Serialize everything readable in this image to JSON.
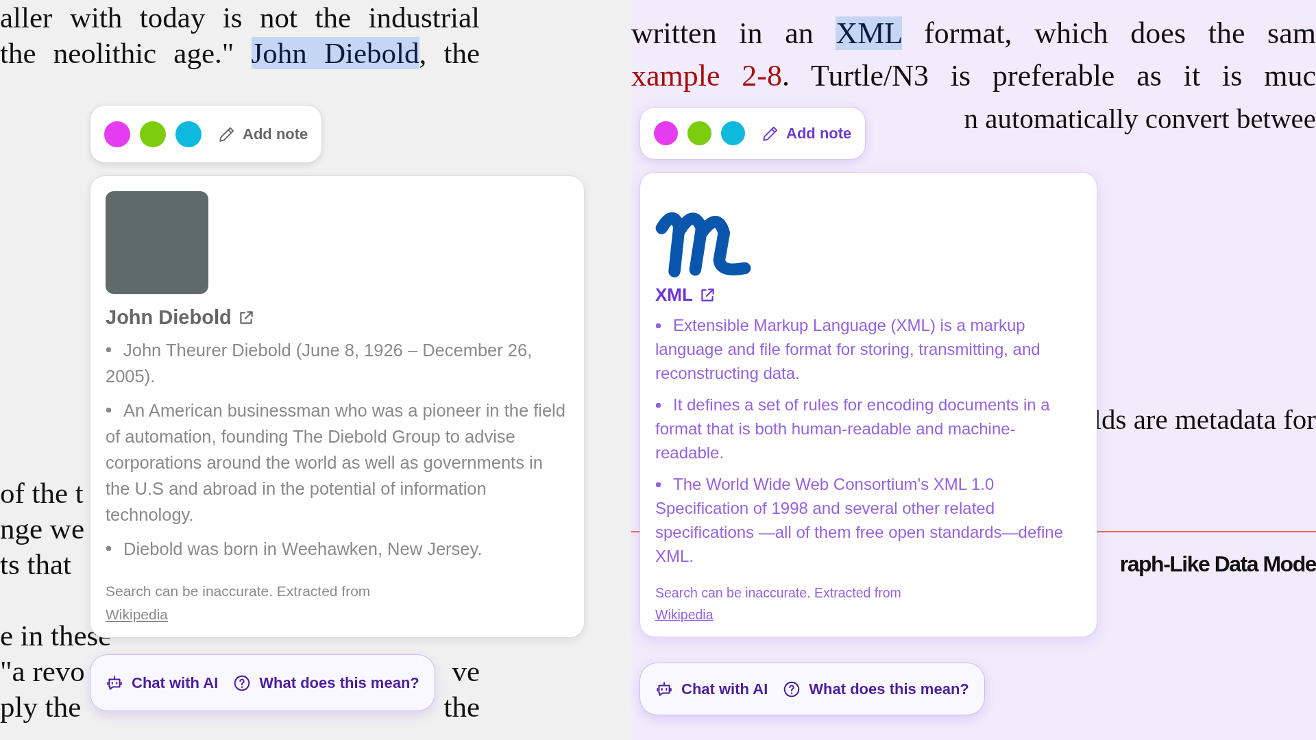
{
  "panes": [
    {
      "kind": "gray",
      "blocks": [
        {
          "lines": [
            {
              "kind": "full",
              "left": [
                {
                  "kind": "plain",
                  "text": "aller with today is not the industrial"
                }
              ]
            },
            {
              "kind": "full",
              "left": [
                {
                  "kind": "plain",
                  "text": "the neolithic age.\" "
                },
                {
                  "kind": "highlight",
                  "text": "John Diebold"
                },
                {
                  "kind": "plain",
                  "text": ", the"
                }
              ]
            }
          ]
        },
        {
          "lines": [
            {
              "kind": "split",
              "left": [
                {
                  "kind": "plain",
                  "text": "of the t"
                }
              ]
            },
            {
              "kind": "split",
              "left": [
                {
                  "kind": "plain",
                  "text": "nge we"
                }
              ]
            },
            {
              "kind": "split",
              "left": [
                {
                  "kind": "plain",
                  "text": "ts that"
                }
              ]
            }
          ]
        },
        {
          "lines": [
            {
              "kind": "split",
              "left": [
                {
                  "kind": "plain",
                  "text": "e in these"
                }
              ]
            },
            {
              "kind": "split",
              "left": [
                {
                  "kind": "plain",
                  "text": "\"a revo"
                }
              ],
              "right": [
                {
                  "kind": "plain",
                  "text": "ve"
                }
              ]
            },
            {
              "kind": "split",
              "left": [
                {
                  "kind": "plain",
                  "text": "ply the"
                }
              ],
              "right": [
                {
                  "kind": "plain",
                  "text": "the"
                }
              ]
            }
          ]
        }
      ],
      "toolbar": {
        "colors": [
          {
            "color": "#e63cf0"
          },
          {
            "color": "#7dcc0e"
          },
          {
            "color": "#0db9dc"
          }
        ],
        "add_note": "Add note"
      },
      "card": {
        "kind": "photo",
        "title": "John Diebold",
        "bullets": [
          "John Theurer Diebold (June 8, 1926 – December 26, 2005).",
          "An American businessman who was a pioneer in the field of automation, founding The Diebold Group to advise corporations around the world as well as governments in the U.S and abroad in the potential of information technology.",
          "Diebold was born in Weehawken, New Jersey."
        ],
        "footer": "Search can be inaccurate. Extracted from",
        "source": "Wikipedia"
      },
      "actions": [
        {
          "kind": "chat",
          "label": "Chat with AI"
        },
        {
          "kind": "explain",
          "label": "What does this mean?"
        }
      ]
    },
    {
      "kind": "lavender",
      "blocks": [
        {
          "lines": [
            {
              "kind": "full",
              "left": [
                {
                  "kind": "plain",
                  "text": "written in an "
                },
                {
                  "kind": "highlight",
                  "text": "XML"
                },
                {
                  "kind": "plain",
                  "text": " format, which does the sam"
                }
              ]
            },
            {
              "kind": "full",
              "left": [
                {
                  "kind": "link",
                  "text": "xample 2-8"
                },
                {
                  "kind": "plain",
                  "text": ". Turtle/N3 is preferable as it is muc"
                }
              ]
            },
            {
              "kind": "split",
              "right": [
                {
                  "kind": "plain",
                  "text": "n automatically convert betwee"
                }
              ]
            }
          ]
        },
        {
          "lines": [
            {
              "kind": "split",
              "right": [
                {
                  "kind": "plain",
                  "text": "lds are metadata for"
                }
              ]
            }
          ]
        },
        {
          "lines": [
            {
              "kind": "heading",
              "right": [
                {
                  "kind": "heading",
                  "text": "raph-Like Data Mode"
                }
              ]
            }
          ]
        }
      ],
      "toolbar": {
        "colors": [
          {
            "color": "#e63cf0"
          },
          {
            "color": "#7dcc0e"
          },
          {
            "color": "#0db9dc"
          }
        ],
        "add_note": "Add note"
      },
      "card": {
        "kind": "logo",
        "title": "XML",
        "bullets": [
          "Extensible Markup Language (XML) is a markup language and file format for storing, transmitting, and reconstructing data.",
          "It defines a set of rules for encoding documents in a format that is both human-readable and machine-readable.",
          "The World Wide Web Consortium's XML 1.0 Specification of 1998 and several other related specifications —all of them free open standards—define XML."
        ],
        "footer": "Search can be inaccurate. Extracted from",
        "source": "Wikipedia"
      },
      "actions": [
        {
          "kind": "chat",
          "label": "Chat with AI"
        },
        {
          "kind": "explain",
          "label": "What does this mean?"
        }
      ]
    }
  ]
}
